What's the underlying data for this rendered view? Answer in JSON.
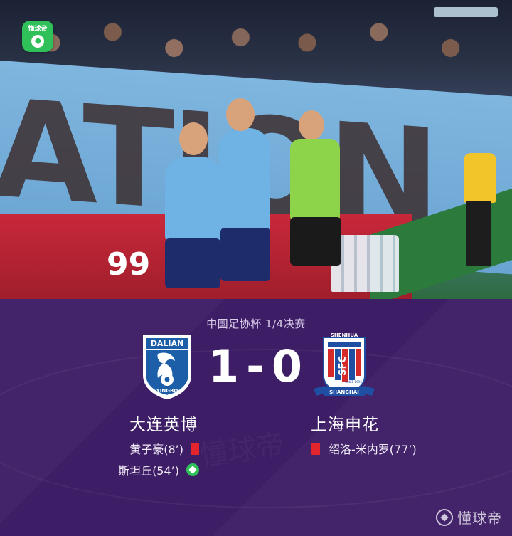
{
  "app": {
    "badge_label": "懂球帝",
    "watermark": "懂球帝"
  },
  "photo": {
    "banner_text": "ATION",
    "ad_number": "99"
  },
  "match": {
    "competition": "中国足协杯 1/4决赛",
    "score": {
      "home": "1",
      "separator": "-",
      "away": "0"
    },
    "home": {
      "name": "大连英博",
      "crest_top": "DALIAN",
      "crest_bottom": "YINGBO",
      "crest_year": "2009",
      "events": [
        {
          "text": "黄子豪(8’)",
          "type": "red-card"
        },
        {
          "text": "斯坦丘(54’)",
          "type": "goal"
        }
      ]
    },
    "away": {
      "name": "上海申花",
      "crest_top": "SHENHUA",
      "crest_bottom": "SHANGHAI",
      "crest_letters": "SFC",
      "crest_year": "SINCE 1993",
      "events": [
        {
          "text": "绍洛-米内罗(77’)",
          "type": "red-card"
        }
      ]
    }
  },
  "colors": {
    "panel_bg": "#3d1d66",
    "home_crest_blue": "#1d5ea8",
    "away_crest_blue": "#1f4fa3",
    "away_crest_red": "#d62a2a",
    "red_card": "#e2242c",
    "goal_icon": "#2fc05a"
  }
}
